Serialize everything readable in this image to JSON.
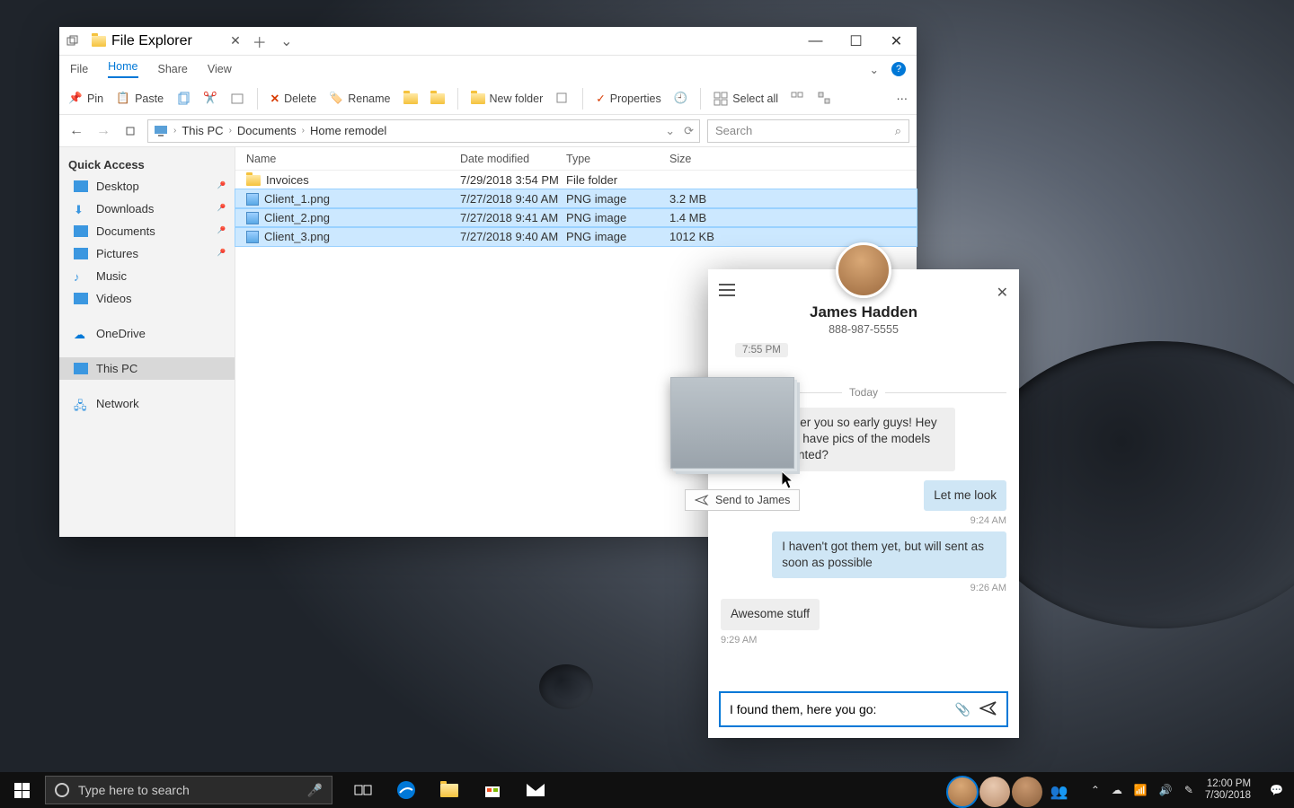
{
  "explorer": {
    "tab_title": "File Explorer",
    "menu": {
      "file": "File",
      "home": "Home",
      "share": "Share",
      "view": "View"
    },
    "ribbon": {
      "pin": "Pin",
      "paste": "Paste",
      "delete": "Delete",
      "rename": "Rename",
      "new_folder": "New folder",
      "properties": "Properties",
      "select_all": "Select all"
    },
    "breadcrumb": {
      "root": "This PC",
      "l1": "Documents",
      "l2": "Home remodel"
    },
    "search_placeholder": "Search",
    "nav": {
      "quick_access": "Quick Access",
      "desktop": "Desktop",
      "downloads": "Downloads",
      "documents": "Documents",
      "pictures": "Pictures",
      "music": "Music",
      "videos": "Videos",
      "onedrive": "OneDrive",
      "this_pc": "This PC",
      "network": "Network"
    },
    "columns": {
      "name": "Name",
      "date": "Date modified",
      "type": "Type",
      "size": "Size"
    },
    "rows": [
      {
        "name": "Invoices",
        "date": "7/29/2018 3:54 PM",
        "type": "File folder",
        "size": "",
        "kind": "folder",
        "selected": false
      },
      {
        "name": "Client_1.png",
        "date": "7/27/2018 9:40 AM",
        "type": "PNG image",
        "size": "3.2 MB",
        "kind": "png",
        "selected": true
      },
      {
        "name": "Client_2.png",
        "date": "7/27/2018 9:41 AM",
        "type": "PNG image",
        "size": "1.4 MB",
        "kind": "png",
        "selected": true
      },
      {
        "name": "Client_3.png",
        "date": "7/27/2018 9:40 AM",
        "type": "PNG image",
        "size": "1012 KB",
        "kind": "png",
        "selected": true
      }
    ]
  },
  "chat": {
    "contact_name": "James Hadden",
    "contact_phone": "888-987-5555",
    "prev_time": "7:55 PM",
    "divider": "Today",
    "messages": [
      {
        "dir": "in",
        "text": "Sorry to bother you so early guys! Hey guys, do you have pics of the models the client wanted?",
        "ts": ""
      },
      {
        "dir": "out",
        "text": "Let me look",
        "ts": "9:24 AM"
      },
      {
        "dir": "out",
        "text": "I haven't got them yet, but will sent as soon as possible",
        "ts": "9:26 AM"
      },
      {
        "dir": "in",
        "text": "Awesome stuff",
        "ts": "9:29 AM"
      }
    ],
    "input_value": "I found them, here you go:",
    "drag_tooltip": "Send to James"
  },
  "taskbar": {
    "search_placeholder": "Type here to search",
    "time": "12:00 PM",
    "date": "7/30/2018"
  }
}
